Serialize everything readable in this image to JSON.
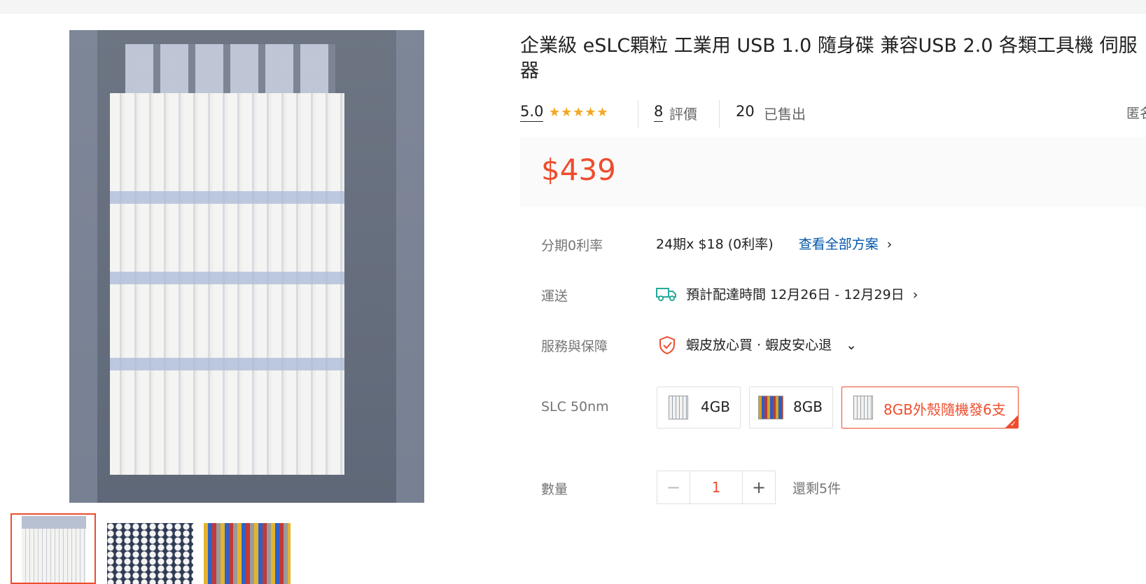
{
  "product": {
    "title": "企業級 eSLC顆粒 工業用 USB 1.0 隨身碟 兼容USB 2.0 各類工具機 伺服器",
    "rating": "5.0",
    "stars": "★★★★★",
    "review_count": "8",
    "review_label": "評價",
    "sold_count": "20",
    "sold_label": "已售出",
    "report_label": "匿名檢舉",
    "price": "$439"
  },
  "installment": {
    "label": "分期0利率",
    "value": "24期x $18 (0利率)",
    "link": "查看全部方案"
  },
  "shipping": {
    "label": "運送",
    "value": "預計配達時間 12月26日 - 12月29日",
    "icon": "truck-icon"
  },
  "service": {
    "label": "服務與保障",
    "value": "蝦皮放心買 · 蝦皮安心退",
    "icon": "shield-icon"
  },
  "variants": {
    "label": "SLC 50nm",
    "options": [
      {
        "label": "4GB"
      },
      {
        "label": "8GB"
      },
      {
        "label": "8GB外殼隨機發6支",
        "selected": true
      }
    ]
  },
  "quantity": {
    "label": "數量",
    "value": "1",
    "minus": "−",
    "plus": "+",
    "stock": "還剩5件"
  },
  "colors": {
    "accent": "#ee4d2d",
    "link": "#0055aa",
    "star": "#f5a623"
  }
}
